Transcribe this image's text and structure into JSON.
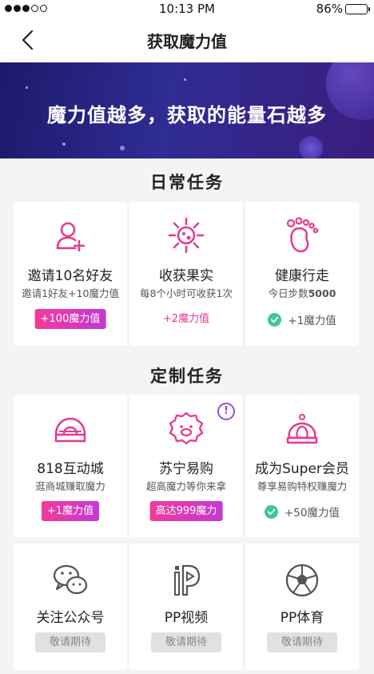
{
  "status": {
    "time": "10:13 PM",
    "battery": "86%",
    "battery_level": 0.86
  },
  "nav": {
    "title": "获取魔力值"
  },
  "banner": {
    "text": "魔力值越多，获取的能量石越多"
  },
  "sections": {
    "daily": "日常任务",
    "custom": "定制任务"
  },
  "daily": [
    {
      "title": "邀请10名好友",
      "sub": "邀请1好友+10魔力值",
      "action": "+100魔力值",
      "icon": "add-user-icon"
    },
    {
      "title": "收获果实",
      "sub": "每8个小时可收获1次",
      "action": "+2魔力值",
      "icon": "fruit-icon"
    },
    {
      "title": "健康行走",
      "sub_prefix": "今日步数",
      "sub_value": "5000",
      "action": "+1魔力值",
      "icon": "footprint-icon"
    }
  ],
  "custom": [
    {
      "title": "818互动城",
      "sub": "逛商城赚取魔力",
      "action": "+1魔力值",
      "icon": "donut-icon"
    },
    {
      "title": "苏宁易购",
      "sub": "超高魔力等你来拿",
      "action": "高达999魔力",
      "icon": "suning-icon",
      "badge": "!"
    },
    {
      "title": "成为Super会员",
      "sub": "尊享易购特权赚魔力",
      "action": "+50魔力值",
      "icon": "crown-icon"
    }
  ],
  "upcoming": [
    {
      "title": "关注公众号",
      "action": "敬请期待",
      "icon": "wechat-icon"
    },
    {
      "title": "PP视频",
      "action": "敬请期待",
      "icon": "pp-video-icon"
    },
    {
      "title": "PP体育",
      "action": "敬请期待",
      "icon": "soccer-ball-icon"
    }
  ],
  "colors": {
    "accent": "#e8388f",
    "accent_purple": "#c43ad4",
    "banner": "#2a2788",
    "success": "#3fc88f"
  }
}
